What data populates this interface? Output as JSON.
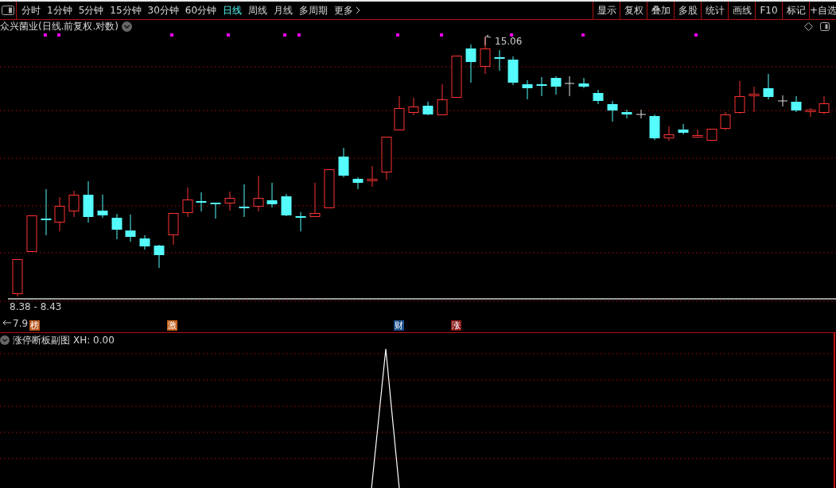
{
  "toolbar": {
    "periods": [
      {
        "label": "分时",
        "selected": false
      },
      {
        "label": "1分钟",
        "selected": false
      },
      {
        "label": "5分钟",
        "selected": false
      },
      {
        "label": "15分钟",
        "selected": false
      },
      {
        "label": "30分钟",
        "selected": false
      },
      {
        "label": "60分钟",
        "selected": false
      },
      {
        "label": "日线",
        "selected": true
      },
      {
        "label": "周线",
        "selected": false
      },
      {
        "label": "月线",
        "selected": false
      },
      {
        "label": "多周期",
        "selected": false
      }
    ],
    "more": "更多",
    "actions": [
      "显示",
      "复权",
      "叠加",
      "多股",
      "统计",
      "画线",
      "F10",
      "标记",
      "+自选"
    ]
  },
  "chart": {
    "title": "众兴菌业(日线.前复权.对数)",
    "high_label": "15.06",
    "range_label": "8.38 - 8.43",
    "low_label": "7.9",
    "event_badges": [
      {
        "text": "榜",
        "color": "#b8561c"
      },
      {
        "text": "激",
        "color": "#c2601c"
      },
      {
        "text": "财",
        "color": "#1d4f8c"
      },
      {
        "text": "涨",
        "color": "#8c1a1a"
      }
    ]
  },
  "indicator": {
    "name": "涨停断板副图",
    "value": "XH: 0.00"
  }
}
